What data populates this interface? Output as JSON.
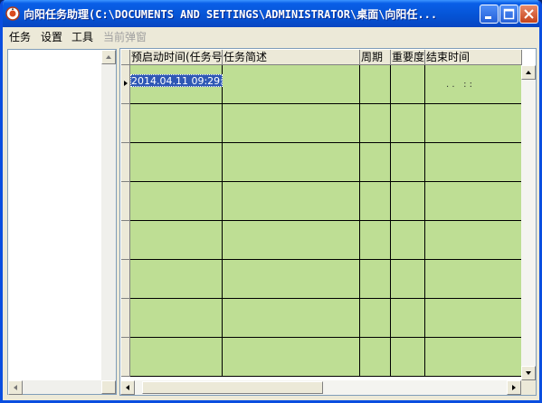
{
  "window": {
    "title": "向阳任务助理(C:\\DOCUMENTS AND SETTINGS\\ADMINISTRATOR\\桌面\\向阳任..."
  },
  "menu": {
    "items": [
      {
        "label": "任务",
        "enabled": true
      },
      {
        "label": "设置",
        "enabled": true
      },
      {
        "label": "工具",
        "enabled": true
      },
      {
        "label": "当前弹窗",
        "enabled": false
      }
    ]
  },
  "grid": {
    "columns": [
      "预启动时间(任务号)",
      "任务简述",
      "周期",
      "重要度",
      "结束时间"
    ],
    "row0": {
      "start_time": "2014.04.11 09:29:",
      "end_time": ". .   : :"
    },
    "cell_color": "#bede94",
    "selection_color": "#2f58b5"
  }
}
